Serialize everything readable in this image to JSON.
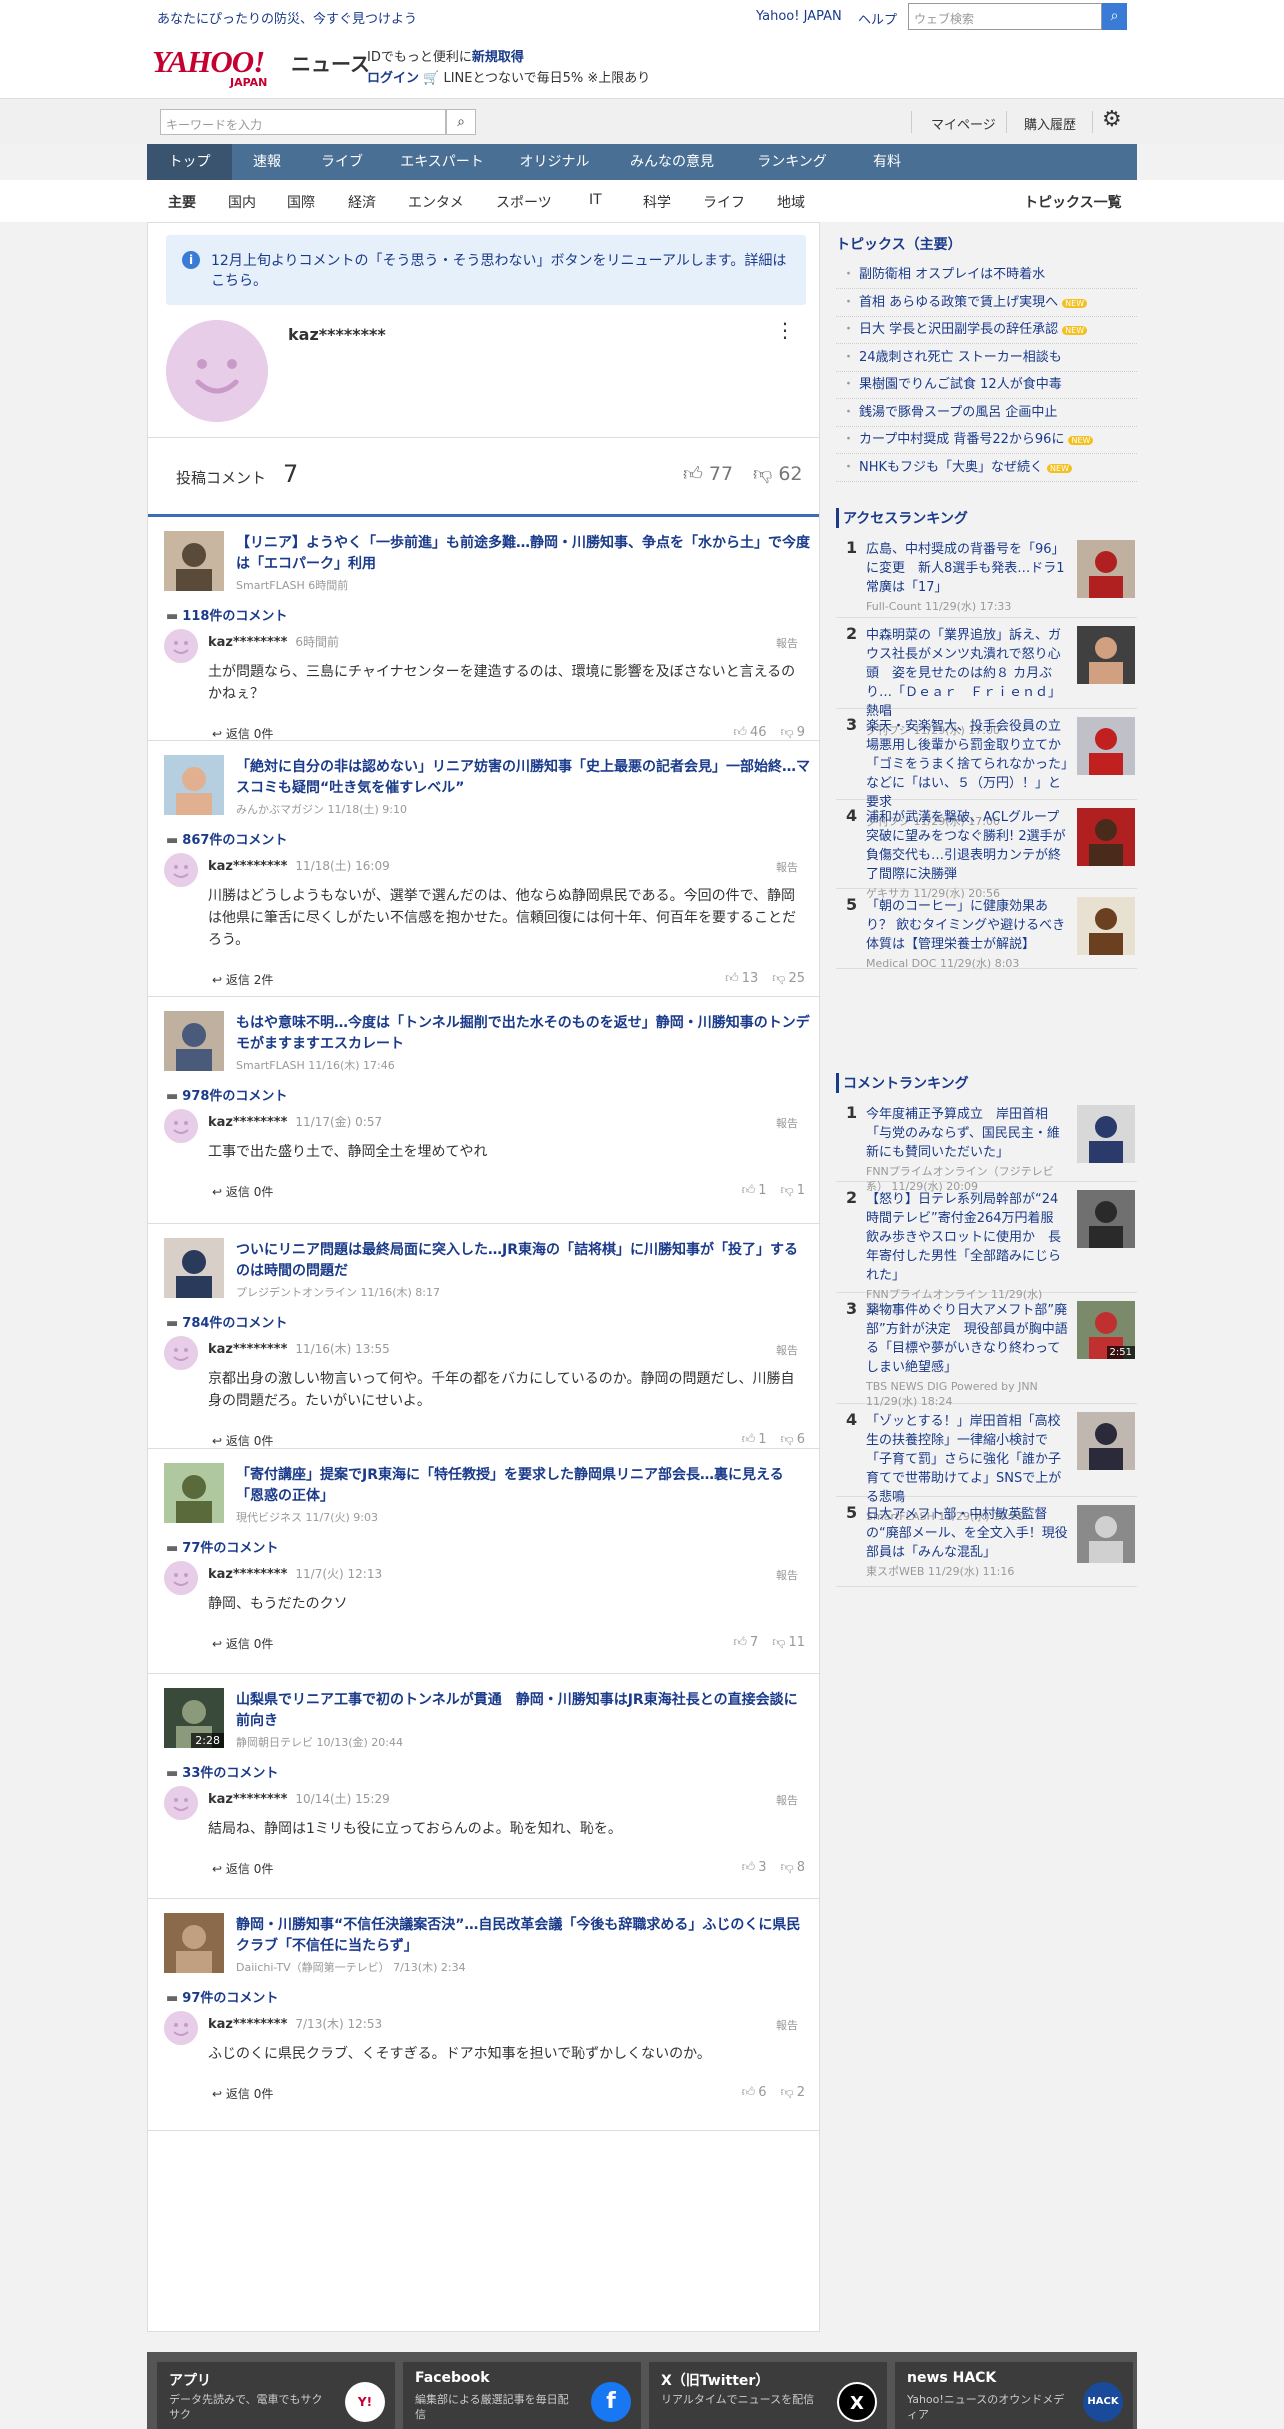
{
  "top": {
    "tagline": "あなたにぴったりの防災、今すぐ見つけよう",
    "yahoo_japan": "Yahoo! JAPAN",
    "help": "ヘルプ",
    "search_placeholder": "ウェブ検索"
  },
  "header": {
    "logo": "YAHOO!",
    "logo_sub": "JAPAN",
    "news": "ニュース",
    "promo1_a": "IDでもっと便利に",
    "promo1_b": "新規取得",
    "promo2_a": "ログイン",
    "promo2_b": "LINEとつないで毎日5% ※上限あり"
  },
  "subhead": {
    "keyword_placeholder": "キーワードを入力",
    "mypage": "マイページ",
    "history": "購入履歴"
  },
  "nav": [
    "トップ",
    "速報",
    "ライブ",
    "エキスパート",
    "オリジナル",
    "みんなの意見",
    "ランキング",
    "有料"
  ],
  "categories": [
    "主要",
    "国内",
    "国際",
    "経済",
    "エンタメ",
    "スポーツ",
    "IT",
    "科学",
    "ライフ",
    "地域"
  ],
  "topics_list": "トピックス一覧",
  "notice": "12月上旬よりコメントの「そう思う・そう思わない」ボタンをリニューアルします。詳細はこちら。",
  "user": {
    "name": "kaz********"
  },
  "stats": {
    "label": "投稿コメント",
    "count": "7",
    "likes": "77",
    "dislikes": "62"
  },
  "entries": [
    {
      "title": "【リニア】ようやく「一歩前進」も前途多難…静岡・川勝知事、争点を「水から土」で今度は「エコパーク」利用",
      "meta": "SmartFLASH 6時間前",
      "comments": "118件のコメント",
      "user": "kaz********",
      "time": "6時間前",
      "report": "報告",
      "text": "土が問題なら、三島にチャイナセンターを建造するのは、環境に影響を及ぼさないと言えるのかねぇ？",
      "reply": "返信 0件",
      "up": "46",
      "down": "9"
    },
    {
      "title": "「絶対に自分の非は認めない」リニア妨害の川勝知事「史上最悪の記者会見」一部始終…マスコミも疑問“吐き気を催すレベル”",
      "meta": "みんかぶマガジン 11/18(土) 9:10",
      "comments": "867件のコメント",
      "user": "kaz********",
      "time": "11/18(土) 16:09",
      "report": "報告",
      "text": "川勝はどうしようもないが、選挙で選んだのは、他ならぬ静岡県民である。今回の件で、静岡は他県に筆舌に尽くしがたい不信感を抱かせた。信頼回復には何十年、何百年を要することだろう。",
      "reply": "返信 2件",
      "up": "13",
      "down": "25"
    },
    {
      "title": "もはや意味不明…今度は「トンネル掘削で出た水そのものを返せ」静岡・川勝知事のトンデモがますますエスカレート",
      "meta": "SmartFLASH 11/16(木) 17:46",
      "comments": "978件のコメント",
      "user": "kaz********",
      "time": "11/17(金) 0:57",
      "report": "報告",
      "text": "工事で出た盛り土で、静岡全土を埋めてやれ",
      "reply": "返信 0件",
      "up": "1",
      "down": "1"
    },
    {
      "title": "ついにリニア問題は最終局面に突入した…JR東海の「詰将棋」に川勝知事が「投了」するのは時間の問題だ",
      "meta": "プレジデントオンライン 11/16(木) 8:17",
      "comments": "784件のコメント",
      "user": "kaz********",
      "time": "11/16(木) 13:55",
      "report": "報告",
      "text": "京都出身の激しい物言いって何や。千年の都をバカにしているのか。静岡の問題だし、川勝自身の問題だろ。たいがいにせいよ。",
      "reply": "返信 0件",
      "up": "1",
      "down": "6"
    },
    {
      "title": "「寄付講座」提案でJR東海に「特任教授」を要求した静岡県リニア部会長…裏に見える「恩惑の正体」",
      "meta": "現代ビジネス 11/7(火) 9:03",
      "comments": "77件のコメント",
      "user": "kaz********",
      "time": "11/7(火) 12:13",
      "report": "報告",
      "text": "静岡、もうだたのクソ",
      "reply": "返信 0件",
      "up": "7",
      "down": "11"
    },
    {
      "title": "山梨県でリニア工事で初のトンネルが貫通　静岡・川勝知事はJR東海社長との直接会談に前向き",
      "meta": "静岡朝日テレビ 10/13(金) 20:44",
      "comments": "33件のコメント",
      "user": "kaz********",
      "time": "10/14(土) 15:29",
      "report": "報告",
      "text": "結局ね、静岡は1ミリも役に立っておらんのよ。恥を知れ、恥を。",
      "reply": "返信 0件",
      "up": "3",
      "down": "8",
      "video": "2:28"
    },
    {
      "title": "静岡・川勝知事“不信任決議案否決”…自民改革会議「今後も辞職求める」ふじのくに県民クラブ「不信任に当たらず」",
      "meta": "Daiichi-TV（静岡第一テレビ） 7/13(木) 2:34",
      "comments": "97件のコメント",
      "user": "kaz********",
      "time": "7/13(木) 12:53",
      "report": "報告",
      "text": "ふじのくに県民クラブ、くそすぎる。ドアホ知事を担いで恥ずかしくないのか。",
      "reply": "返信 0件",
      "up": "6",
      "down": "2"
    }
  ],
  "topics": {
    "heading": "トピックス（主要）",
    "items": [
      {
        "text": "副防衛相 オスプレイは不時着水",
        "new": ""
      },
      {
        "text": "首相 あらゆる政策で賃上げ実現へ",
        "new": "NEW"
      },
      {
        "text": "日大 学長と沢田副学長の辞任承認",
        "new": "NEW"
      },
      {
        "text": "24歳刺され死亡 ストーカー相談も",
        "new": ""
      },
      {
        "text": "果樹園でりんご試食 12人が食中毒",
        "new": ""
      },
      {
        "text": "銭湯で豚骨スープの風呂 企画中止",
        "new": ""
      },
      {
        "text": "カープ中村奨成 背番号22から96に",
        "new": "NEW"
      },
      {
        "text": "NHKもフジも「大奥」なぜ続く",
        "new": "NEW"
      }
    ]
  },
  "access_ranking": {
    "heading": "アクセスランキング",
    "items": [
      {
        "n": "1",
        "title": "広島、中村奨成の背番号を「96」に変更　新人8選手も発表…ドラ1常廣は「17」",
        "source": "Full-Count 11/29(水) 17:33"
      },
      {
        "n": "2",
        "title": "中森明菜の「業界追放」訴え、ガウス社長がメンツ丸潰れで怒り心頭　姿を見せたのは約８ カ月ぶり…「Ｄｅａｒ　Ｆｒｉｅｎｄ」熱唱",
        "source": "夕刊フジ 11/29(水) 17:00"
      },
      {
        "n": "3",
        "title": "楽天・安楽智大、投手会役員の立場悪用し後輩から罰金取り立てか「ゴミをうまく捨てられなかった」などに「はい、５（万円）！」と要求",
        "source": "夕刊フジ 11/29(水) 17:00"
      },
      {
        "n": "4",
        "title": "浦和が武漢を撃破、ACLグループ突破に望みをつなぐ勝利! 2選手が負傷交代も…引退表明カンテが終了間際に決勝弾",
        "source": "ゲキサカ 11/29(水) 20:56"
      },
      {
        "n": "5",
        "title": "「朝のコーヒー」に健康効果あり？ 飲むタイミングや避けるべき体質は【管理栄養士が解説】",
        "source": "Medical DOC 11/29(水) 8:03"
      }
    ]
  },
  "comment_ranking": {
    "heading": "コメントランキング",
    "items": [
      {
        "n": "1",
        "title": "今年度補正予算成立　岸田首相「与党のみならず、国民民主・維新にも賛同いただいた」",
        "source": "FNNプライムオンライン（フジテレビ系） 11/29(水) 20:09"
      },
      {
        "n": "2",
        "title": "【怒り】日テレ系列局幹部が“24時間テレビ”寄付金264万円着服　飲み歩きやスロットに使用か　長年寄付した男性「全部踏みにじられた」",
        "source": "FNNプライムオンライン 11/29(水) 14:27"
      },
      {
        "n": "3",
        "title": "薬物事件めぐり日大アメフト部”廃部”方針が決定　現役部員が胸中語る「目標や夢がいきなり終わってしまい絶望感」",
        "source": "TBS NEWS DIG Powered by JNN 11/29(水) 18:24",
        "video": "2:51"
      },
      {
        "n": "4",
        "title": "「ゾッとする！」岸田首相「高校生の扶養控除」一律縮小検討で「子育て罰」さらに強化「誰か子育てで世帯助けてよ」SNSで上がる悲鳴",
        "source": "SmartFLASH 11/29(水) 15:29"
      },
      {
        "n": "5",
        "title": "日大アメフト部・中村敏英監督の“廃部メール、を全文入手！現役部員は「みんな混乱」",
        "source": "東スポWEB 11/29(水) 11:16"
      }
    ]
  },
  "footer": [
    {
      "title": "アプリ",
      "desc": "データ先読みで、電車でもサクサク",
      "icon": "Y!"
    },
    {
      "title": "Facebook",
      "desc": "編集部による厳選記事を毎日配信",
      "icon": "f"
    },
    {
      "title": "X（旧Twitter）",
      "desc": "リアルタイムでニュースを配信",
      "icon": "X"
    },
    {
      "title": "news HACK",
      "desc": "Yahoo!ニュースのオウンドメディア",
      "icon": "HACK"
    }
  ],
  "colors": {
    "link": "#1a3a8a",
    "nav": "#4a6f94",
    "accent": "#3a6fb8",
    "logo": "#c3002f"
  }
}
